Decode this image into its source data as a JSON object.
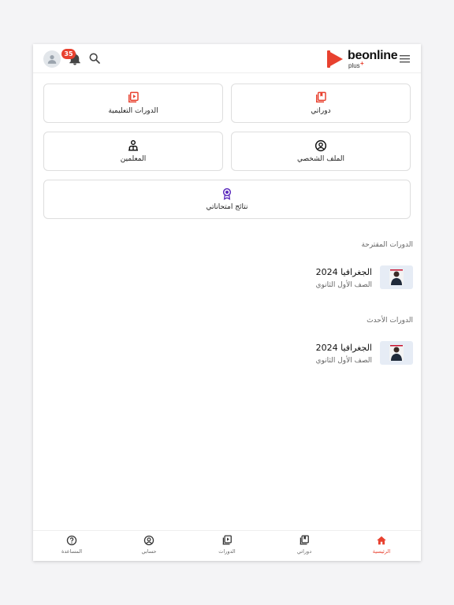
{
  "header": {
    "logo_text": "beonline",
    "logo_subtext": "plus",
    "notification_count": "35",
    "colors": {
      "brand": "#e8412f",
      "icon": "#444444"
    },
    "icons": [
      "avatar-icon",
      "bell-icon",
      "search-icon",
      "menu-icon"
    ]
  },
  "cards": {
    "my_courses": {
      "label": "دوراتي",
      "icon": "library-icon"
    },
    "courses": {
      "label": "الدورات التعليمية",
      "icon": "video-library-icon"
    },
    "profile": {
      "label": "الملف الشخصي",
      "icon": "user-circle-icon"
    },
    "teachers": {
      "label": "المعلمين",
      "icon": "teacher-icon"
    },
    "results": {
      "label": "نتائج امتحاناتي",
      "icon": "award-icon"
    }
  },
  "sections": {
    "suggested": {
      "title": "الدورات المقترحة",
      "items": [
        {
          "title": "الجغرافيا 2024",
          "subtitle": "الصف الأول الثانوي"
        }
      ]
    },
    "latest": {
      "title": "الدورات الأحدث",
      "items": [
        {
          "title": "الجغرافيا 2024",
          "subtitle": "الصف الأول الثانوي"
        }
      ]
    }
  },
  "bottom_nav": {
    "items": [
      {
        "label": "الرئيسية",
        "icon": "home-icon",
        "active": true
      },
      {
        "label": "دوراتي",
        "icon": "library-icon",
        "active": false
      },
      {
        "label": "الدورات",
        "icon": "video-library-icon",
        "active": false
      },
      {
        "label": "حسابي",
        "icon": "user-circle-icon",
        "active": false
      },
      {
        "label": "المساعدة",
        "icon": "help-icon",
        "active": false
      }
    ]
  },
  "colors": {
    "accent": "#e8412f",
    "purple": "#5b2bbd",
    "text": "#222222"
  }
}
